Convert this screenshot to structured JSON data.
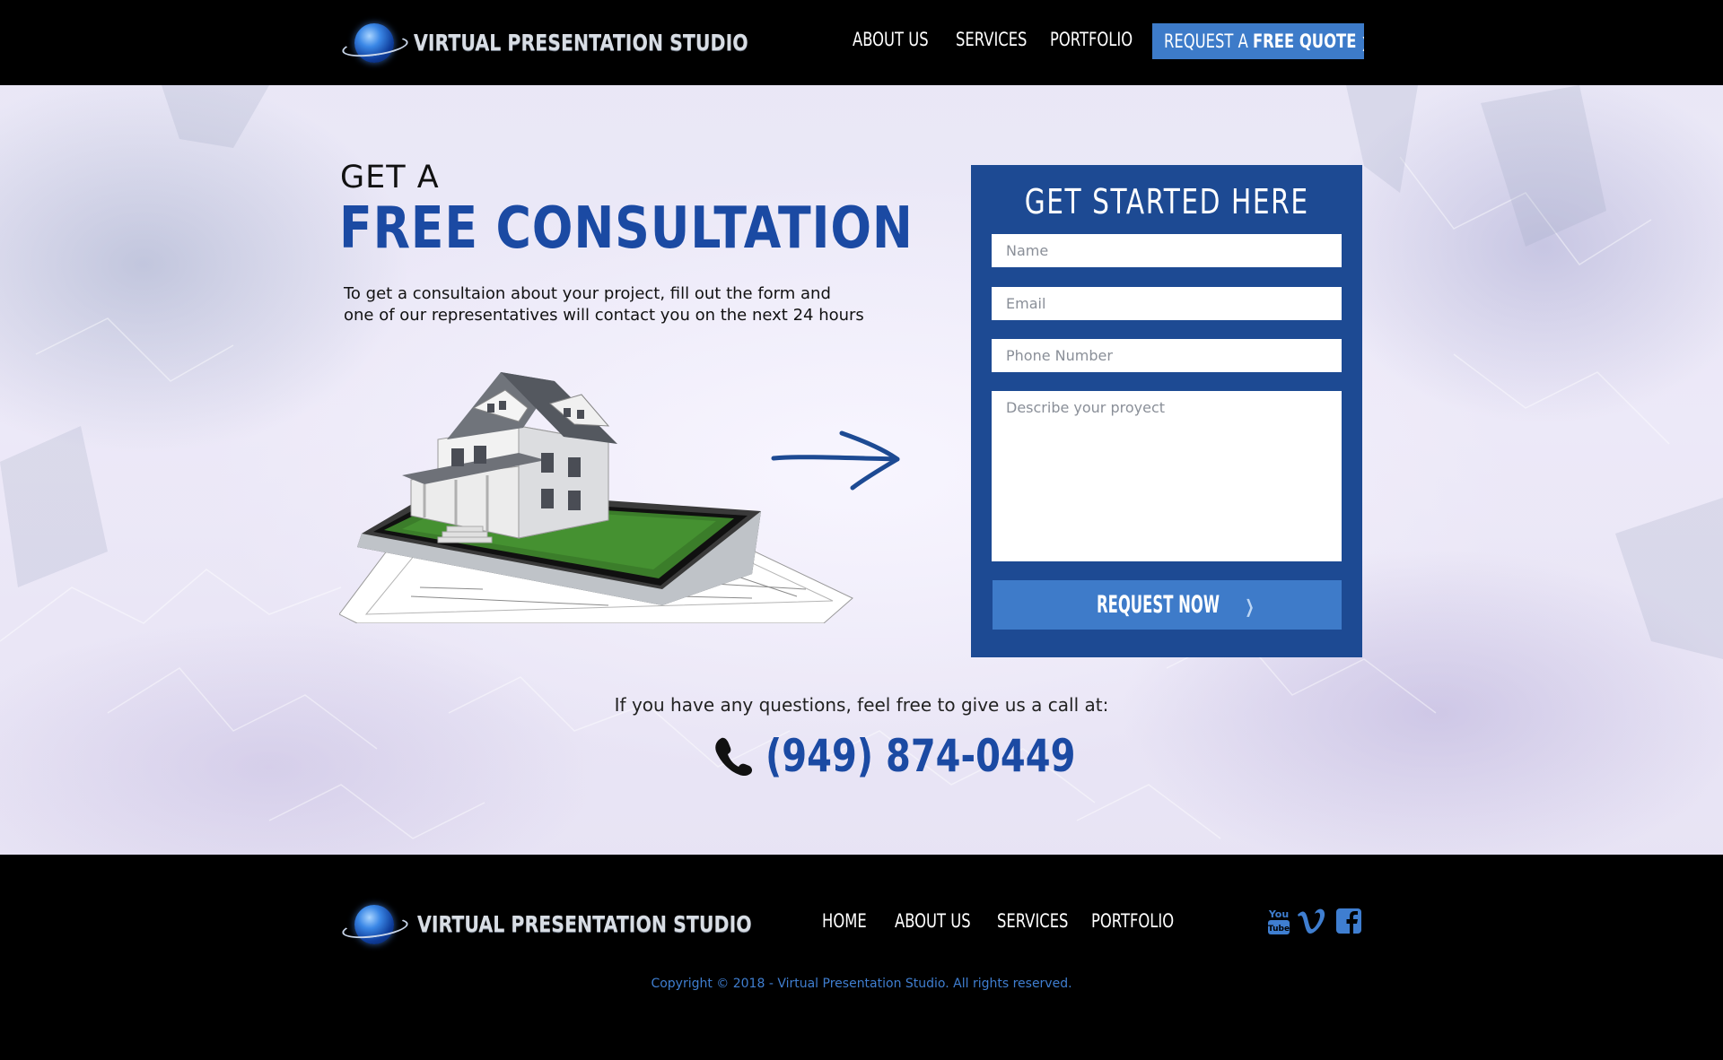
{
  "brand": {
    "name": "VIRTUAL PRESENTATION STUDIO",
    "logo_icon": "globe-logo-icon"
  },
  "header": {
    "nav": [
      "ABOUT US",
      "SERVICES",
      "PORTFOLIO"
    ],
    "quote_button": {
      "prefix": "REQUEST A ",
      "bold": "FREE QUOTE",
      "chevron": "❯"
    }
  },
  "hero": {
    "kicker": "GET A",
    "title": "FREE CONSULTATION",
    "description_lines": [
      "To get a consultaion about your project, fill out the form and",
      "one of our representatives will contact you on the next 24 hours"
    ]
  },
  "form": {
    "title": "GET STARTED HERE",
    "name_placeholder": "Name",
    "email_placeholder": "Email",
    "phone_placeholder": "Phone Number",
    "description_placeholder": "Describe your proyect",
    "submit_label": "REQUEST NOW",
    "submit_chevron": "❯"
  },
  "contact": {
    "call_text": "If you have any questions, feel free to give us a call at:",
    "phone": "(949) 874-0449",
    "phone_icon": "phone-icon"
  },
  "footer": {
    "nav": [
      "HOME",
      "ABOUT US",
      "SERVICES",
      "PORTFOLIO"
    ],
    "social": [
      "youtube-icon",
      "vimeo-icon",
      "facebook-icon"
    ],
    "social_labels": {
      "youtube_top": "You",
      "youtube_bottom": "Tube"
    },
    "copyright": "Copyright © 2018 - Virtual Presentation Studio. All rights reserved."
  },
  "colors": {
    "brand_blue": "#1b4aa3",
    "form_panel": "#1d4a93",
    "accent_button": "#3e7bc9",
    "background": "#000000"
  }
}
